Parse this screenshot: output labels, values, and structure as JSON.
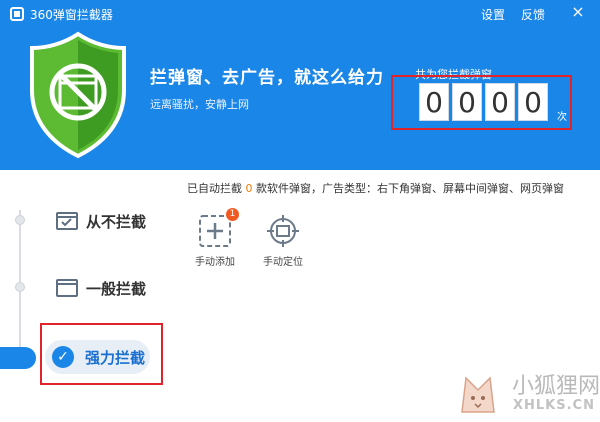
{
  "titlebar": {
    "title": "360弹窗拦截器",
    "settings_label": "设置",
    "feedback_label": "反馈",
    "close_label": "×"
  },
  "hero": {
    "headline": "拦弹窗、去广告，就这么给力",
    "subline": "远离骚扰，安静上网"
  },
  "counter": {
    "label": "共为您拦截弹窗",
    "digits": [
      "0",
      "0",
      "0",
      "0"
    ],
    "unit": "次"
  },
  "modes": [
    {
      "label": "从不拦截",
      "icon": "checkbox-window-icon"
    },
    {
      "label": "一般拦截",
      "icon": "window-icon"
    },
    {
      "label": "强力拦截",
      "icon": "check-circle-icon",
      "active": true
    }
  ],
  "info": {
    "prefix": "已自动拦截",
    "count": "0",
    "suffix": "款软件弹窗，广告类型：右下角弹窗、屏幕中间弹窗、网页弹窗"
  },
  "tools": {
    "add_label": "手动添加",
    "add_badge": "1",
    "locate_label": "手动定位"
  },
  "watermark": {
    "text": "小狐狸网",
    "sub": "XHLKS.CN"
  },
  "colors": {
    "header": "#1a86e8",
    "shield": "#4caf2e",
    "annotation": "#e0242a",
    "accent_orange": "#f57c00"
  }
}
